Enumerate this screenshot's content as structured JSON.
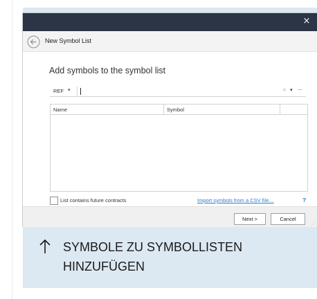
{
  "window": {
    "close_glyph": "×"
  },
  "navbar": {
    "back_icon": "back-arrow-circle-icon",
    "title": "New Symbol List"
  },
  "main": {
    "heading": "Add symbols to the symbol list",
    "search": {
      "ref_label": "REF",
      "ref_caret": "▾",
      "placeholder": "",
      "value": "",
      "clear_glyph": "×",
      "dropdown_glyph": "▾",
      "more_glyph": "···"
    },
    "grid": {
      "columns": [
        "Name",
        "Symbol"
      ],
      "rows": []
    },
    "future_contracts_label": "List contains future contracts",
    "import_link": "Import symbols from a CSV file…",
    "help_label": "?"
  },
  "footer": {
    "next_label": "Next >",
    "cancel_label": "Cancel"
  },
  "caption": {
    "icon": "arrow-up-icon",
    "text": "SYMBOLE ZU SYMBOLLISTEN HINZUFÜGEN"
  },
  "colors": {
    "titlebar": "#2b3546",
    "card_background": "#dce8f2",
    "link": "#2a7fc9"
  }
}
